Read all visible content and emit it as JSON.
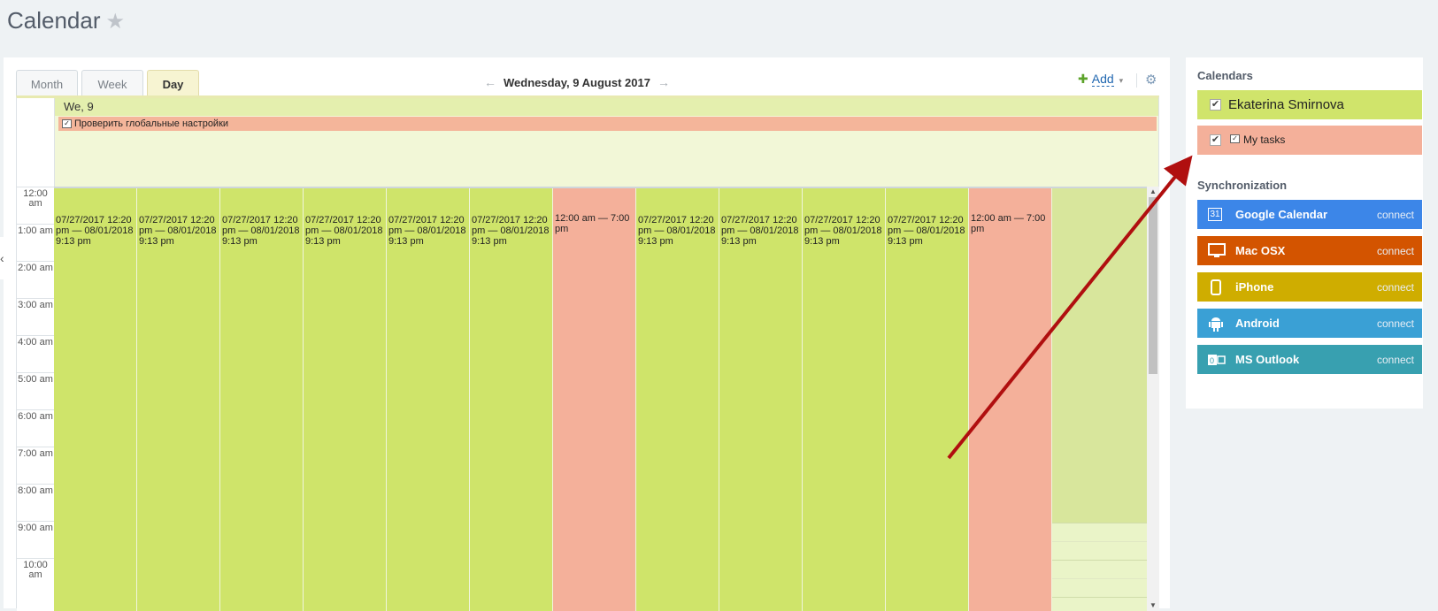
{
  "header": {
    "title": "Calendar",
    "star": "★"
  },
  "tabs": [
    {
      "label": "Month",
      "active": false
    },
    {
      "label": "Week",
      "active": false
    },
    {
      "label": "Day",
      "active": true
    }
  ],
  "nav": {
    "prev": "←",
    "date": "Wednesday, 9 August 2017",
    "next": "→"
  },
  "toolbar": {
    "add_plus": "✚",
    "add_label": "Add",
    "add_caret": "▾",
    "settings_icon": "⚙"
  },
  "allday": {
    "day_label": "We, 9",
    "event": "Проверить глобальные настройки"
  },
  "times": [
    "12:00 am",
    "1:00 am",
    "2:00 am",
    "3:00 am",
    "4:00 am",
    "5:00 am",
    "6:00 am",
    "7:00 am",
    "8:00 am",
    "9:00 am",
    "10:00 am"
  ],
  "events": [
    {
      "text": "07/27/2017 12:20 pm — 08/01/2018 9:13 pm",
      "color": "green"
    },
    {
      "text": "07/27/2017 12:20 pm — 08/01/2018 9:13 pm",
      "color": "green"
    },
    {
      "text": "07/27/2017 12:20 pm — 08/01/2018 9:13 pm",
      "color": "green"
    },
    {
      "text": "07/27/2017 12:20 pm — 08/01/2018 9:13 pm",
      "color": "green"
    },
    {
      "text": "07/27/2017 12:20 pm — 08/01/2018 9:13 pm",
      "color": "green"
    },
    {
      "text": "07/27/2017 12:20 pm — 08/01/2018 9:13 pm",
      "color": "green"
    },
    {
      "text": "12:00 am — 7:00 pm",
      "color": "red"
    },
    {
      "text": "07/27/2017 12:20 pm — 08/01/2018 9:13 pm",
      "color": "green"
    },
    {
      "text": "07/27/2017 12:20 pm — 08/01/2018 9:13 pm",
      "color": "green"
    },
    {
      "text": "07/27/2017 12:20 pm — 08/01/2018 9:13 pm",
      "color": "green"
    },
    {
      "text": "07/27/2017 12:20 pm — 08/01/2018 9:13 pm",
      "color": "green"
    },
    {
      "text": "12:00 am — 7:00 pm",
      "color": "red"
    }
  ],
  "sidebar": {
    "calendars_title": "Calendars",
    "calendars": [
      {
        "name": "Ekaterina Smirnova",
        "checked": "✔",
        "color": "#d0e46b"
      },
      {
        "name": "My tasks",
        "checked": "✔",
        "color": "#f4b09a"
      }
    ],
    "sync_title": "Synchronization",
    "sync": [
      {
        "name": "Google Calendar",
        "action": "connect",
        "color": "#3c86e8",
        "icon": "calendar-icon"
      },
      {
        "name": "Mac OSX",
        "action": "connect",
        "color": "#d35400",
        "icon": "monitor-icon"
      },
      {
        "name": "iPhone",
        "action": "connect",
        "color": "#cfad00",
        "icon": "phone-icon"
      },
      {
        "name": "Android",
        "action": "connect",
        "color": "#3aa0d5",
        "icon": "android-icon"
      },
      {
        "name": "MS Outlook",
        "action": "connect",
        "color": "#38a0b0",
        "icon": "outlook-icon"
      }
    ]
  }
}
